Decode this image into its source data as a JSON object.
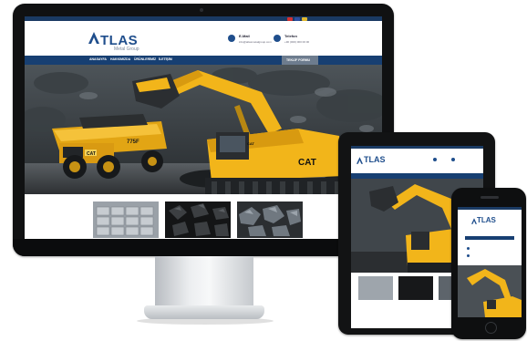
{
  "brand": {
    "name": "TLAS",
    "tagline": "Metal Group"
  },
  "colors": {
    "brand_blue": "#1f4e8c",
    "nav_blue": "#173f72",
    "machine_yellow": "#f2b51a"
  },
  "header": {
    "email_label": "E-Mail",
    "email_value": "info@atlasmetalgroup.com",
    "phone_label": "Telefon",
    "phone_value": "+90 (000) 000 00 00"
  },
  "nav": {
    "items": [
      "ANASAYFA",
      "HAKKIMIZDA",
      "ÜRÜNLERİMİZ",
      "İLETİŞİM"
    ],
    "quote_button": "TEKLİF FORMU"
  },
  "hero": {
    "truck_model": "775F",
    "truck_brand": "CAT",
    "excavator_brand": "CAT",
    "excavator_brand_small": "CAT"
  },
  "icons": [
    "mail-icon",
    "phone-icon",
    "flag-icon"
  ]
}
